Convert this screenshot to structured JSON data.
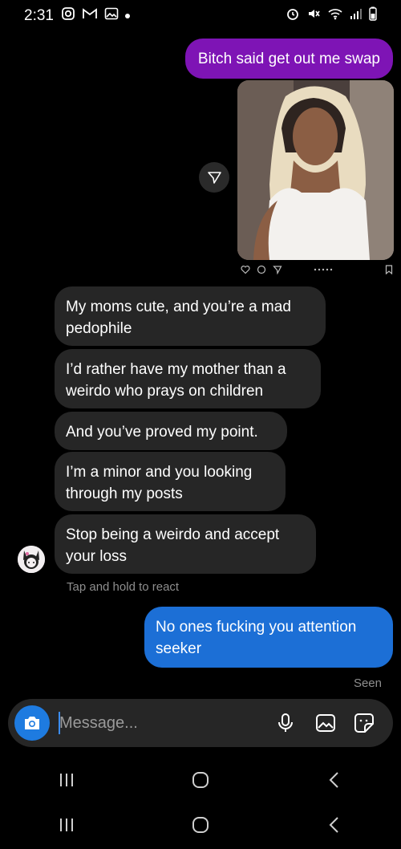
{
  "status_bar": {
    "time": "2:31",
    "left_icons": [
      "instagram-icon",
      "gmail-icon",
      "gallery-icon",
      "notification-dot"
    ],
    "right_icons": [
      "alarm-icon",
      "mute-icon",
      "wifi-icon",
      "signal-icon",
      "battery-icon"
    ]
  },
  "messages": [
    {
      "side": "sent",
      "text": "Bitch said get out me swap",
      "color": "#7e14b5"
    },
    {
      "side": "sent",
      "type": "shared-post-photo"
    },
    {
      "side": "received",
      "text": "My moms cute, and you’re a mad pedophile"
    },
    {
      "side": "received",
      "text": "I’d rather have my mother than a weirdo who prays on children"
    },
    {
      "side": "received",
      "text": "And you’ve proved my point."
    },
    {
      "side": "received",
      "text": "I’m a minor and you looking through my posts"
    },
    {
      "side": "received",
      "text": "Stop being a weirdo and accept your loss"
    },
    {
      "side": "sent",
      "text": "No ones fucking you attention seeker",
      "color": "#1c6fd6"
    }
  ],
  "hint": "Tap and hold to react",
  "seen": "Seen",
  "composer": {
    "placeholder": "Message...",
    "icons": [
      "camera-icon",
      "microphone-icon",
      "gallery-icon",
      "sticker-icon"
    ]
  },
  "colors": {
    "background": "#000000",
    "received_bubble": "#262626",
    "accent_blue": "#1e7be0",
    "purple_bubble": "#7e14b5"
  }
}
